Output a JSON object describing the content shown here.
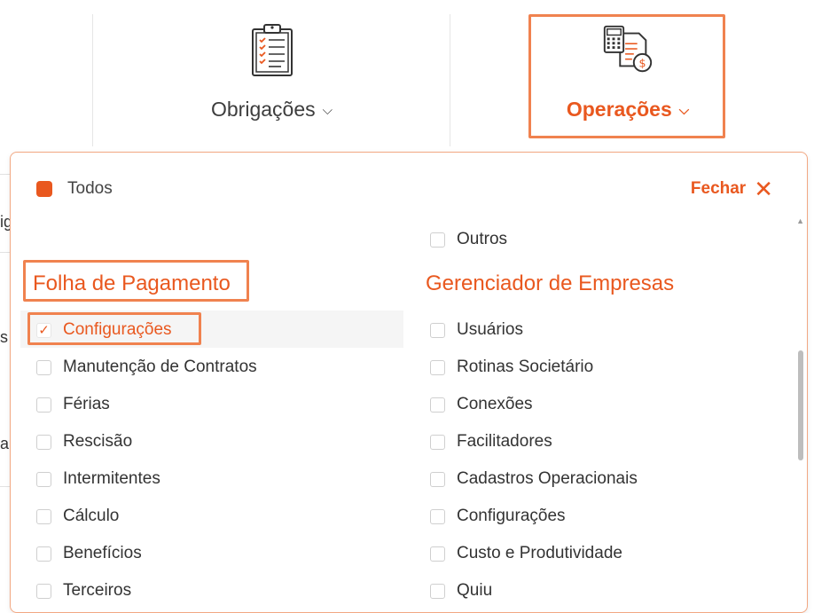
{
  "nav": {
    "obrigacoes_label": "Obrigações",
    "operacoes_label": "Operações",
    "chevron": "⌵"
  },
  "background": {
    "frag1": "ig",
    "frag2": "s",
    "frag3": "a"
  },
  "panel": {
    "todos_label": "Todos",
    "fechar_label": "Fechar",
    "close_glyph": "✕",
    "scroll_up_glyph": "▲",
    "left_column": {
      "title": "Folha de Pagamento",
      "items": [
        {
          "label": "Configurações",
          "checked": true
        },
        {
          "label": "Manutenção de Contratos",
          "checked": false
        },
        {
          "label": "Férias",
          "checked": false
        },
        {
          "label": "Rescisão",
          "checked": false
        },
        {
          "label": "Intermitentes",
          "checked": false
        },
        {
          "label": "Cálculo",
          "checked": false
        },
        {
          "label": "Benefícios",
          "checked": false
        },
        {
          "label": "Terceiros",
          "checked": false
        }
      ]
    },
    "right_column": {
      "top_item": {
        "label": "Outros",
        "checked": false
      },
      "title": "Gerenciador de Empresas",
      "items": [
        {
          "label": "Usuários",
          "checked": false
        },
        {
          "label": "Rotinas Societário",
          "checked": false
        },
        {
          "label": "Conexões",
          "checked": false
        },
        {
          "label": "Facilitadores",
          "checked": false
        },
        {
          "label": "Cadastros Operacionais",
          "checked": false
        },
        {
          "label": "Configurações",
          "checked": false
        },
        {
          "label": "Custo e Produtividade",
          "checked": false
        },
        {
          "label": "Quiu",
          "checked": false
        }
      ]
    }
  },
  "colors": {
    "accent": "#e9581f",
    "highlight_border": "#f0824f"
  }
}
